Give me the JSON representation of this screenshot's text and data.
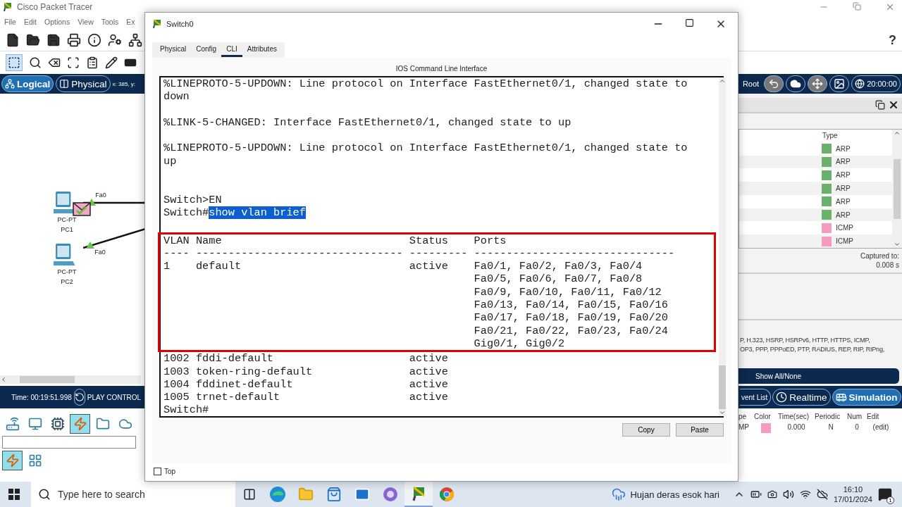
{
  "app": {
    "title": "Cisco Packet Tracer",
    "menu": [
      "File",
      "Edit",
      "Options",
      "View",
      "Tools",
      "Ex"
    ],
    "view_tabs": [
      {
        "label": "Logical",
        "selected": true
      },
      {
        "label": "Physical",
        "selected": false
      }
    ],
    "coordinates": "x: 385, y:",
    "help": "?",
    "root_label": "Root",
    "clock": "20:00:00",
    "devices": [
      {
        "model": "PC-PT",
        "name": "PC1",
        "port": "Fa0",
        "has_packet": true
      },
      {
        "model": "PC-PT",
        "name": "PC2",
        "port": "Fa0",
        "has_packet": false
      }
    ],
    "time": "Time: 00:19:51.998",
    "play_control": "PLAY CONTROL",
    "device_categories": [
      {
        "kind": "network",
        "selected": false
      },
      {
        "kind": "end",
        "selected": false
      },
      {
        "kind": "component",
        "selected": false
      },
      {
        "kind": "connection",
        "selected": true
      },
      {
        "kind": "misc",
        "selected": false
      },
      {
        "kind": "wan",
        "selected": false
      }
    ],
    "connection_types": [
      {
        "kind": "auto",
        "selected": true
      },
      {
        "kind": "grid",
        "selected": false
      }
    ],
    "event_list": {
      "column": "Type",
      "events": [
        {
          "type": "ARP",
          "color": "#6bb06b"
        },
        {
          "type": "ARP",
          "color": "#6bb06b"
        },
        {
          "type": "ARP",
          "color": "#6bb06b"
        },
        {
          "type": "ARP",
          "color": "#6bb06b"
        },
        {
          "type": "ARP",
          "color": "#6bb06b"
        },
        {
          "type": "ARP",
          "color": "#6bb06b"
        },
        {
          "type": "ICMP",
          "color": "#f59ac0"
        },
        {
          "type": "ICMP",
          "color": "#f59ac0"
        }
      ]
    },
    "captured_label": "Captured to:",
    "captured_value": "0.008 s",
    "protocol_filter": [
      "P, H.323, HSRP, HSRPv6, HTTP, HTTPS, ICMP,",
      "OP3, PPP, PPPoED, PTP, RADIUS, REP, RIP, RIPng,"
    ],
    "show_all_button": "Show All/None",
    "event_list_button": "vent List",
    "modes": [
      {
        "label": "Realtime",
        "kind": "realtime",
        "selected": false
      },
      {
        "label": "Simulation",
        "kind": "simulation",
        "selected": true
      }
    ],
    "pdu_table": {
      "columns": [
        "pe",
        "Color",
        "Time(sec)",
        "Periodic",
        "Num",
        "Edit"
      ],
      "rows": [
        {
          "type": "MP",
          "color": "#f59ac0",
          "time": "0.000",
          "periodic": "N",
          "num": "0",
          "edit": "(edit)"
        }
      ]
    }
  },
  "dialog": {
    "title": "Switch0",
    "tabs": [
      {
        "label": "Physical",
        "selected": false
      },
      {
        "label": "Config",
        "selected": false
      },
      {
        "label": "CLI",
        "selected": true
      },
      {
        "label": "Attributes",
        "selected": false
      }
    ],
    "heading": "IOS Command Line Interface",
    "lines_before": [
      {
        "kind": "text",
        "text": "%LINEPROTO-5-UPDOWN: Line protocol on Interface FastEthernet0/1, changed state to"
      },
      {
        "kind": "text",
        "text": "down"
      },
      {
        "kind": "blank"
      },
      {
        "kind": "text",
        "text": "%LINK-5-CHANGED: Interface FastEthernet0/1, changed state to up"
      },
      {
        "kind": "blank"
      },
      {
        "kind": "text",
        "text": "%LINEPROTO-5-UPDOWN: Line protocol on Interface FastEthernet0/1, changed state to"
      },
      {
        "kind": "text",
        "text": "up"
      },
      {
        "kind": "blank"
      },
      {
        "kind": "blank"
      },
      {
        "kind": "text",
        "text": "Switch>EN"
      },
      {
        "kind": "command",
        "prompt": "Switch#",
        "selection": "show vlan brief"
      },
      {
        "kind": "blank"
      }
    ],
    "vlan_table": {
      "header": [
        "VLAN",
        "Name",
        "Status",
        "Ports"
      ],
      "rule": [
        "----",
        "--------------------------------",
        "---------",
        "-------------------------------"
      ],
      "rows": [
        {
          "vlan": "1",
          "name": "default",
          "status": "active",
          "ports": [
            "Fa0/1, Fa0/2, Fa0/3, Fa0/4",
            "Fa0/5, Fa0/6, Fa0/7, Fa0/8",
            "Fa0/9, Fa0/10, Fa0/11, Fa0/12",
            "Fa0/13, Fa0/14, Fa0/15, Fa0/16",
            "Fa0/17, Fa0/18, Fa0/19, Fa0/20",
            "Fa0/21, Fa0/22, Fa0/23, Fa0/24",
            "Gig0/1, Gig0/2"
          ]
        }
      ]
    },
    "rows_below_frame": [
      {
        "vlan": "1002",
        "name": "fddi-default",
        "status": "active"
      },
      {
        "vlan": "1003",
        "name": "token-ring-default",
        "status": "active"
      },
      {
        "vlan": "1004",
        "name": "fddinet-default",
        "status": "active"
      },
      {
        "vlan": "1005",
        "name": "trnet-default",
        "status": "active"
      }
    ],
    "lines_after": [
      {
        "kind": "text",
        "text": "Switch#"
      }
    ],
    "buttons": [
      "Copy",
      "Paste"
    ],
    "top_checkbox": {
      "label": "Top",
      "checked": false
    }
  },
  "taskbar": {
    "search_placeholder": "Type here to search",
    "weather": "Hujan deras esok hari",
    "time": "16:10",
    "date": "17/01/2024",
    "notification_count": "1"
  }
}
